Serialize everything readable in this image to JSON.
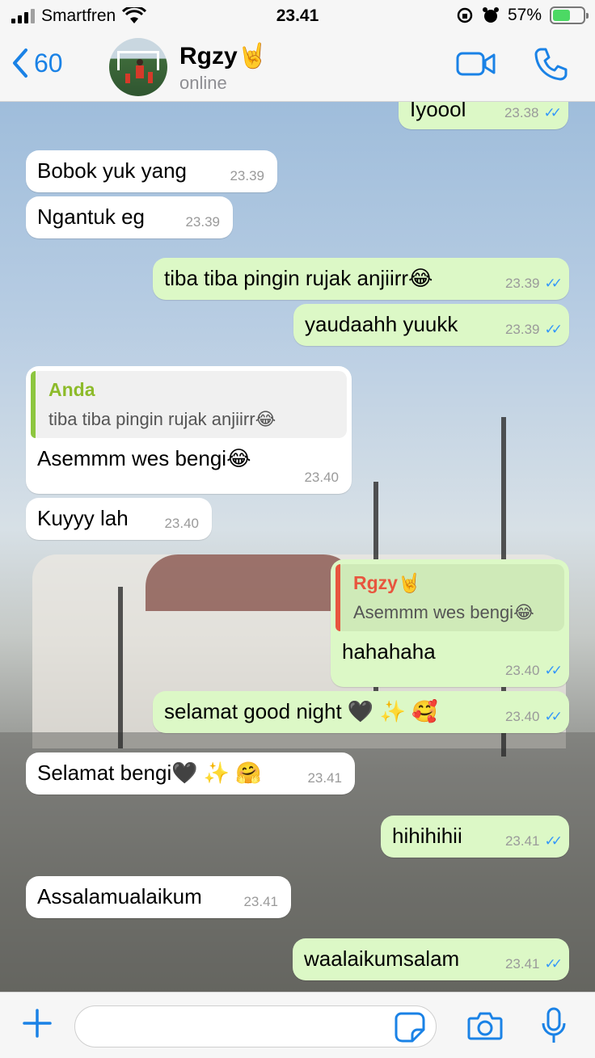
{
  "status_bar": {
    "carrier": "Smartfren",
    "time": "23.41",
    "battery": "57%",
    "battery_level": 0.57
  },
  "header": {
    "back_count": "60",
    "contact_name": "Rgzy🤘",
    "contact_status": "online"
  },
  "messages": [
    {
      "dir": "out",
      "text": "Iyoool",
      "time": "23.38",
      "ticks": "✓✓"
    },
    {
      "dir": "in",
      "text": "Bobok yuk yang",
      "time": "23.39"
    },
    {
      "dir": "in",
      "text": "Ngantuk eg",
      "time": "23.39"
    },
    {
      "dir": "out",
      "text": "tiba tiba pingin rujak anjiirr😂",
      "time": "23.39",
      "ticks": "✓✓"
    },
    {
      "dir": "out",
      "text": "yaudaahh yuukk",
      "time": "23.39",
      "ticks": "✓✓"
    },
    {
      "dir": "in",
      "text": "Asemmm wes bengi😂",
      "time": "23.40",
      "quote_author": "Anda",
      "quote_text": "tiba tiba pingin rujak anjiirr😂"
    },
    {
      "dir": "in",
      "text": "Kuyyy lah",
      "time": "23.40"
    },
    {
      "dir": "out",
      "text": "hahahaha",
      "time": "23.40",
      "ticks": "✓✓",
      "quote_author": "Rgzy🤘",
      "quote_text": "Asemmm wes bengi😂"
    },
    {
      "dir": "out",
      "text": "selamat good night 🖤 ✨ 🥰",
      "time": "23.40",
      "ticks": "✓✓"
    },
    {
      "dir": "in",
      "text": "Selamat bengi🖤 ✨ 🤗",
      "time": "23.41"
    },
    {
      "dir": "out",
      "text": "hihihihii",
      "time": "23.41",
      "ticks": "✓✓"
    },
    {
      "dir": "in",
      "text": "Assalamualaikum",
      "time": "23.41"
    },
    {
      "dir": "out",
      "text": "waalaikumsalam",
      "time": "23.41",
      "ticks": "✓✓"
    }
  ],
  "composer": {
    "placeholder": ""
  },
  "colors": {
    "accent": "#1a82e6",
    "outgoing_bubble": "#dcf8c6",
    "incoming_bubble": "#ffffff",
    "read_ticks": "#3497f9"
  }
}
